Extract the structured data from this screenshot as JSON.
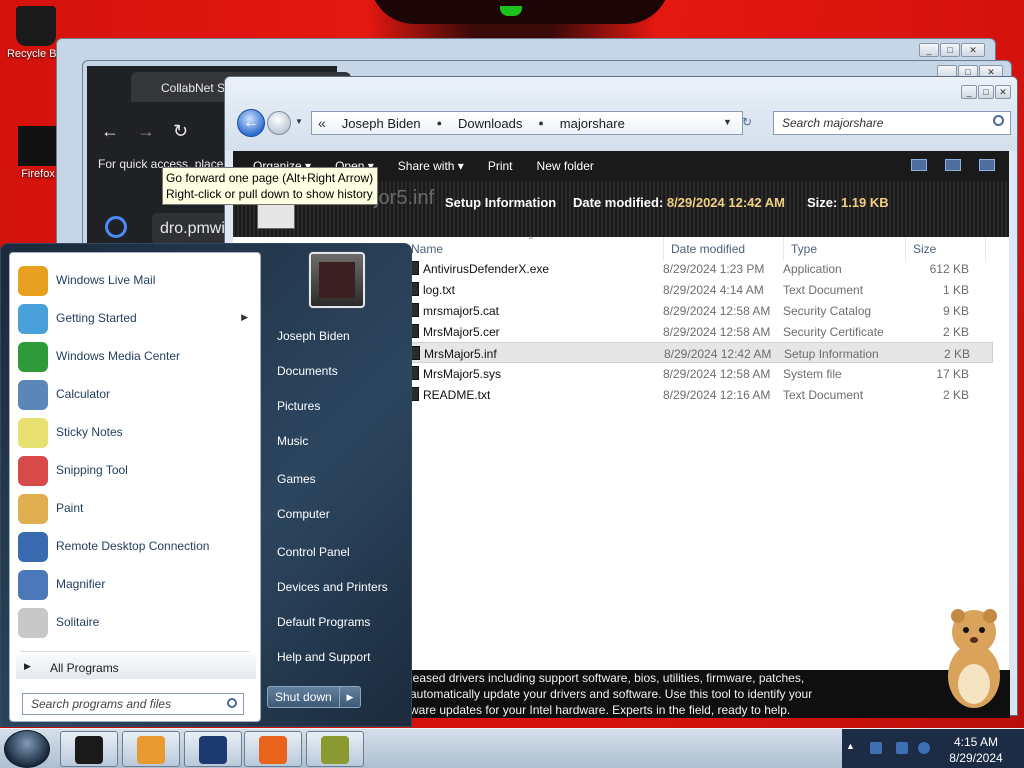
{
  "desktop": {
    "icons": [
      {
        "label": "Recycle Bin",
        "color": "#1a1a1a"
      },
      {
        "label": "Firefox",
        "color": "#111111"
      }
    ]
  },
  "browser": {
    "tab_title": "CollabNet Se",
    "nav": {
      "back": "←",
      "forward": "→",
      "reload": "↻"
    },
    "quick_access": "For quick access, place",
    "address_text": "dro.pmwi"
  },
  "tooltip": {
    "line1": "Go forward one page (Alt+Right Arrow)",
    "line2": "Right-click or pull down to show history"
  },
  "explorer": {
    "breadcrumbs": [
      "Joseph Biden",
      "Downloads",
      "majorshare"
    ],
    "breadcrumb_prefix": "«",
    "search_placeholder": "Search majorshare",
    "toolbar": {
      "organize": "Organize ▾",
      "open": "Open ▾",
      "share_with": "Share with ▾",
      "print": "Print",
      "new_folder": "New folder"
    },
    "details": {
      "ghost_name": "MrsMajor5.inf",
      "type": "Setup Information",
      "modified_label": "Date modified:",
      "modified_value": "8/29/2024 12:42 AM",
      "size_label": "Size:",
      "size_value": "1.19 KB"
    },
    "columns": {
      "name": "Name",
      "date": "Date modified",
      "type": "Type",
      "size": "Size"
    },
    "files": [
      {
        "name": "AntivirusDefenderX.exe",
        "date": "8/29/2024 1:23 PM",
        "type": "Application",
        "size": "612 KB",
        "selected": false
      },
      {
        "name": "log.txt",
        "date": "8/29/2024 4:14 AM",
        "type": "Text Document",
        "size": "1 KB",
        "selected": false
      },
      {
        "name": "mrsmajor5.cat",
        "date": "8/29/2024 12:58 AM",
        "type": "Security Catalog",
        "size": "9 KB",
        "selected": false
      },
      {
        "name": "MrsMajor5.cer",
        "date": "8/29/2024 12:58 AM",
        "type": "Security Certificate",
        "size": "2 KB",
        "selected": false
      },
      {
        "name": "MrsMajor5.inf",
        "date": "8/29/2024 12:42 AM",
        "type": "Setup Information",
        "size": "2 KB",
        "selected": true
      },
      {
        "name": "MrsMajor5.sys",
        "date": "8/29/2024 12:58 AM",
        "type": "System file",
        "size": "17 KB",
        "selected": false
      },
      {
        "name": "README.txt",
        "date": "8/29/2024 12:16 AM",
        "type": "Text Document",
        "size": "2 KB",
        "selected": false
      }
    ]
  },
  "blurb": {
    "line1": "leased drivers including support software, bios, utilities, firmware, patches,",
    "line2": "automatically update your drivers and software. Use this tool to identify your",
    "line3": "ware updates for your Intel hardware. Experts in the field, ready to help."
  },
  "start_menu": {
    "programs": [
      {
        "label": "Windows Live Mail",
        "color": "#e8a020",
        "submenu": false
      },
      {
        "label": "Getting Started",
        "color": "#4aa0d8",
        "submenu": true
      },
      {
        "label": "Windows Media Center",
        "color": "#2f9a3a",
        "submenu": false
      },
      {
        "label": "Calculator",
        "color": "#5a86b8",
        "submenu": false
      },
      {
        "label": "Sticky Notes",
        "color": "#e8e070",
        "submenu": false
      },
      {
        "label": "Snipping Tool",
        "color": "#d84a4a",
        "submenu": false
      },
      {
        "label": "Paint",
        "color": "#e0b050",
        "submenu": false
      },
      {
        "label": "Remote Desktop Connection",
        "color": "#3a6ab0",
        "submenu": false
      },
      {
        "label": "Magnifier",
        "color": "#4a78b8",
        "submenu": false
      },
      {
        "label": "Solitaire",
        "color": "#c8c8c8",
        "submenu": false
      }
    ],
    "all_programs": "All Programs",
    "search_placeholder": "Search programs and files",
    "right_links": [
      "Joseph Biden",
      "Documents",
      "Pictures",
      "Music",
      "Games",
      "Computer",
      "Control Panel",
      "Devices and Printers",
      "Default Programs",
      "Help and Support"
    ],
    "shutdown": "Shut down",
    "shutdown_arrow": "▶"
  },
  "taskbar": {
    "buttons": [
      {
        "name": "taskbar-app-1",
        "color": "#1a1a1a"
      },
      {
        "name": "taskbar-app-2",
        "color": "#e89a30"
      },
      {
        "name": "taskbar-app-3",
        "color": "#1c3a70"
      },
      {
        "name": "taskbar-app-4",
        "color": "#e8641c"
      },
      {
        "name": "taskbar-app-5",
        "color": "#8a9a30"
      }
    ],
    "clock_time": "4:15 AM",
    "clock_date": "8/29/2024"
  }
}
